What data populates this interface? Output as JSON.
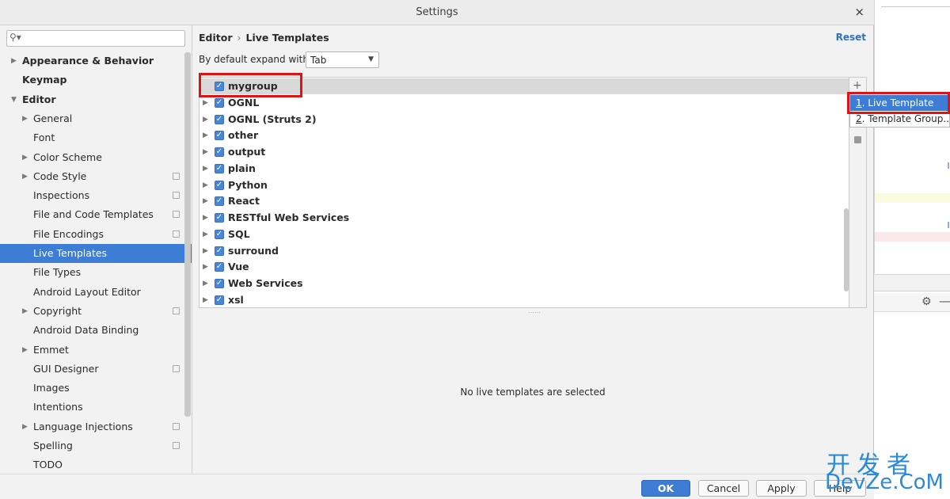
{
  "window": {
    "title": "Settings",
    "close_glyph": "×"
  },
  "search": {
    "placeholder": "",
    "icon": "search-icon"
  },
  "sidebar": {
    "items": [
      {
        "label": "Appearance & Behavior",
        "level": 0,
        "bold": true,
        "expandable": true,
        "expanded": false,
        "project": false,
        "selected": false
      },
      {
        "label": "Keymap",
        "level": 0,
        "bold": true,
        "expandable": false,
        "expanded": false,
        "project": false,
        "selected": false
      },
      {
        "label": "Editor",
        "level": 0,
        "bold": true,
        "expandable": true,
        "expanded": true,
        "project": false,
        "selected": false
      },
      {
        "label": "General",
        "level": 1,
        "bold": false,
        "expandable": true,
        "expanded": false,
        "project": false,
        "selected": false
      },
      {
        "label": "Font",
        "level": 1,
        "bold": false,
        "expandable": false,
        "expanded": false,
        "project": false,
        "selected": false
      },
      {
        "label": "Color Scheme",
        "level": 1,
        "bold": false,
        "expandable": true,
        "expanded": false,
        "project": false,
        "selected": false
      },
      {
        "label": "Code Style",
        "level": 1,
        "bold": false,
        "expandable": true,
        "expanded": false,
        "project": true,
        "selected": false
      },
      {
        "label": "Inspections",
        "level": 1,
        "bold": false,
        "expandable": false,
        "expanded": false,
        "project": true,
        "selected": false
      },
      {
        "label": "File and Code Templates",
        "level": 1,
        "bold": false,
        "expandable": false,
        "expanded": false,
        "project": true,
        "selected": false
      },
      {
        "label": "File Encodings",
        "level": 1,
        "bold": false,
        "expandable": false,
        "expanded": false,
        "project": true,
        "selected": false
      },
      {
        "label": "Live Templates",
        "level": 1,
        "bold": false,
        "expandable": false,
        "expanded": false,
        "project": false,
        "selected": true
      },
      {
        "label": "File Types",
        "level": 1,
        "bold": false,
        "expandable": false,
        "expanded": false,
        "project": false,
        "selected": false
      },
      {
        "label": "Android Layout Editor",
        "level": 1,
        "bold": false,
        "expandable": false,
        "expanded": false,
        "project": false,
        "selected": false
      },
      {
        "label": "Copyright",
        "level": 1,
        "bold": false,
        "expandable": true,
        "expanded": false,
        "project": true,
        "selected": false
      },
      {
        "label": "Android Data Binding",
        "level": 1,
        "bold": false,
        "expandable": false,
        "expanded": false,
        "project": false,
        "selected": false
      },
      {
        "label": "Emmet",
        "level": 1,
        "bold": false,
        "expandable": true,
        "expanded": false,
        "project": false,
        "selected": false
      },
      {
        "label": "GUI Designer",
        "level": 1,
        "bold": false,
        "expandable": false,
        "expanded": false,
        "project": true,
        "selected": false
      },
      {
        "label": "Images",
        "level": 1,
        "bold": false,
        "expandable": false,
        "expanded": false,
        "project": false,
        "selected": false
      },
      {
        "label": "Intentions",
        "level": 1,
        "bold": false,
        "expandable": false,
        "expanded": false,
        "project": false,
        "selected": false
      },
      {
        "label": "Language Injections",
        "level": 1,
        "bold": false,
        "expandable": true,
        "expanded": false,
        "project": true,
        "selected": false
      },
      {
        "label": "Spelling",
        "level": 1,
        "bold": false,
        "expandable": false,
        "expanded": false,
        "project": true,
        "selected": false
      },
      {
        "label": "TODO",
        "level": 1,
        "bold": false,
        "expandable": false,
        "expanded": false,
        "project": false,
        "selected": false
      }
    ]
  },
  "header": {
    "breadcrumb_parent": "Editor",
    "breadcrumb_sep": "›",
    "breadcrumb_current": "Live Templates",
    "reset_label": "Reset"
  },
  "expand": {
    "label": "By default expand with",
    "value": "Tab"
  },
  "templates": {
    "groups": [
      {
        "name": "mygroup",
        "checked": true,
        "expandable": false,
        "selected": true
      },
      {
        "name": "OGNL",
        "checked": true,
        "expandable": true,
        "selected": false
      },
      {
        "name": "OGNL (Struts 2)",
        "checked": true,
        "expandable": true,
        "selected": false
      },
      {
        "name": "other",
        "checked": true,
        "expandable": true,
        "selected": false
      },
      {
        "name": "output",
        "checked": true,
        "expandable": true,
        "selected": false
      },
      {
        "name": "plain",
        "checked": true,
        "expandable": true,
        "selected": false
      },
      {
        "name": "Python",
        "checked": true,
        "expandable": true,
        "selected": false
      },
      {
        "name": "React",
        "checked": true,
        "expandable": true,
        "selected": false
      },
      {
        "name": "RESTful Web Services",
        "checked": true,
        "expandable": true,
        "selected": false
      },
      {
        "name": "SQL",
        "checked": true,
        "expandable": true,
        "selected": false
      },
      {
        "name": "surround",
        "checked": true,
        "expandable": true,
        "selected": false
      },
      {
        "name": "Vue",
        "checked": true,
        "expandable": true,
        "selected": false
      },
      {
        "name": "Web Services",
        "checked": true,
        "expandable": true,
        "selected": false
      },
      {
        "name": "xsl",
        "checked": true,
        "expandable": true,
        "selected": false
      }
    ],
    "empty_message": "No live templates are selected"
  },
  "toolbar": {
    "add_glyph": "+"
  },
  "popup": {
    "items": [
      {
        "mnemonic": "1",
        "label": ". Live Template",
        "active": true
      },
      {
        "mnemonic": "2",
        "label": ". Template Group...",
        "active": false
      }
    ]
  },
  "footer": {
    "ok_label": "OK",
    "cancel_label": "Cancel",
    "apply_label": "Apply",
    "help_label": "Help"
  },
  "watermark": {
    "line1": "开发者",
    "line2": "DevZe.CoM"
  },
  "colors": {
    "accent": "#3d7dd6",
    "annotation": "#e01212",
    "link": "#2f6fc4"
  }
}
